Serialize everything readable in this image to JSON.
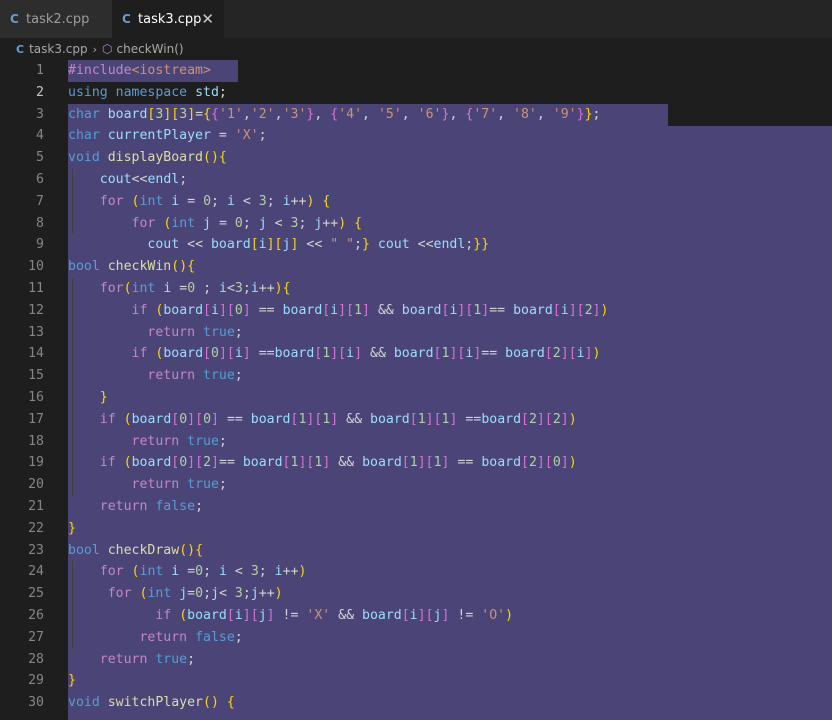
{
  "tabs": [
    {
      "label": "task2.cpp",
      "active": false
    },
    {
      "label": "task3.cpp",
      "active": true
    }
  ],
  "breadcrumb": {
    "file": "task3.cpp",
    "symbol": "checkWin()"
  },
  "colors": {
    "selection": "#4a4576",
    "editor_bg": "#1e1e1e",
    "keyword": "#569cd6",
    "function": "#dcdcaa",
    "variable": "#9cdcfe",
    "string": "#ce9178",
    "number": "#b5cea8",
    "control": "#c586c0"
  },
  "editor": {
    "current_line": 2,
    "lines": [
      {
        "n": "1",
        "text": "#include<iostream>"
      },
      {
        "n": "2",
        "text": "using namespace std;"
      },
      {
        "n": "3",
        "text": "char board[3][3]={{'1','2','3'}, {'4', '5', '6'}, {'7', '8', '9'}};"
      },
      {
        "n": "4",
        "text": "char currentPlayer = 'X';"
      },
      {
        "n": "5",
        "text": "void displayBoard(){"
      },
      {
        "n": "6",
        "text": "    cout<<endl;"
      },
      {
        "n": "7",
        "text": "    for (int i = 0; i < 3; i++) {"
      },
      {
        "n": "8",
        "text": "        for (int j = 0; j < 3; j++) {"
      },
      {
        "n": "9",
        "text": "          cout << board[i][j] << \" \";} cout <<endl;}}"
      },
      {
        "n": "10",
        "text": "bool checkWin(){"
      },
      {
        "n": "11",
        "text": "    for(int i =0 ; i<3;i++){"
      },
      {
        "n": "12",
        "text": "        if (board[i][0] == board[i][1] && board[i][1]== board[i][2])"
      },
      {
        "n": "13",
        "text": "          return true;"
      },
      {
        "n": "14",
        "text": "        if (board[0][i] ==board[1][i] && board[1][i]== board[2][i])"
      },
      {
        "n": "15",
        "text": "          return true;"
      },
      {
        "n": "16",
        "text": "    }"
      },
      {
        "n": "17",
        "text": "    if (board[0][0] == board[1][1] && board[1][1] ==board[2][2])"
      },
      {
        "n": "18",
        "text": "        return true;"
      },
      {
        "n": "19",
        "text": "    if (board[0][2]== board[1][1] && board[1][1] == board[2][0])"
      },
      {
        "n": "20",
        "text": "        return true;"
      },
      {
        "n": "21",
        "text": "    return false;"
      },
      {
        "n": "22",
        "text": "}"
      },
      {
        "n": "23",
        "text": "bool checkDraw(){"
      },
      {
        "n": "24",
        "text": "    for (int i =0; i < 3; i++)"
      },
      {
        "n": "25",
        "text": "     for (int j=0;j< 3;j++)"
      },
      {
        "n": "26",
        "text": "           if (board[i][j] != 'X' && board[i][j] != 'O')"
      },
      {
        "n": "27",
        "text": "         return false;"
      },
      {
        "n": "28",
        "text": "    return true;"
      },
      {
        "n": "29",
        "text": "}"
      },
      {
        "n": "30",
        "text": "void switchPlayer() {"
      }
    ]
  }
}
